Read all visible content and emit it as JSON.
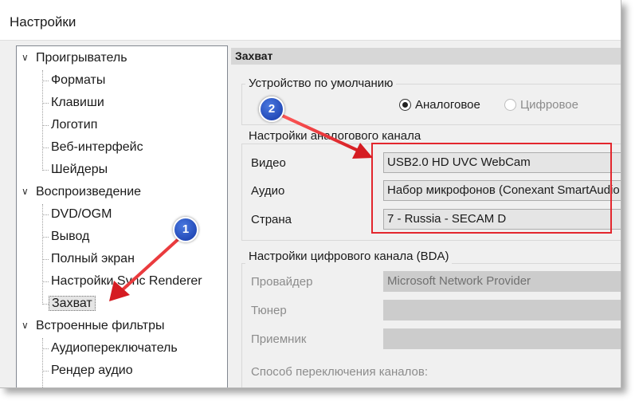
{
  "window": {
    "title": "Настройки"
  },
  "tree": {
    "groups": [
      {
        "label": "Проигрыватель",
        "children": [
          "Форматы",
          "Клавиши",
          "Логотип",
          "Веб-интерфейс",
          "Шейдеры"
        ]
      },
      {
        "label": "Воспроизведение",
        "children": [
          "DVD/OGM",
          "Вывод",
          "Полный экран",
          "Настройки Sync Renderer",
          "Захват"
        ]
      },
      {
        "label": "Встроенные фильтры",
        "children": [
          "Аудиопереключатель",
          "Рендер аудио"
        ]
      }
    ],
    "selected": "Захват"
  },
  "panel": {
    "header": "Захват",
    "default_device": {
      "label": "Устройство по умолчанию",
      "analog": "Аналоговое",
      "digital": "Цифровое",
      "selected": "analog"
    },
    "analog": {
      "label": "Настройки аналогового канала",
      "video_label": "Видео",
      "video_value": "USB2.0 HD UVC WebCam",
      "audio_label": "Аудио",
      "audio_value": "Набор микрофонов (Conexant SmartAudio HD)",
      "country_label": "Страна",
      "country_value": "7 - Russia - SECAM D"
    },
    "digital": {
      "label": "Настройки цифрового канала (BDA)",
      "provider_label": "Провайдер",
      "provider_value": "Microsoft Network Provider",
      "tuner_label": "Тюнер",
      "tuner_value": "",
      "receiver_label": "Приемник",
      "receiver_value": "",
      "switch_label": "Способ переключения каналов:"
    }
  },
  "annotations": {
    "badge1": "1",
    "badge2": "2",
    "arrow_color": "#e3262d",
    "badge_color": "#1f4fc7"
  }
}
